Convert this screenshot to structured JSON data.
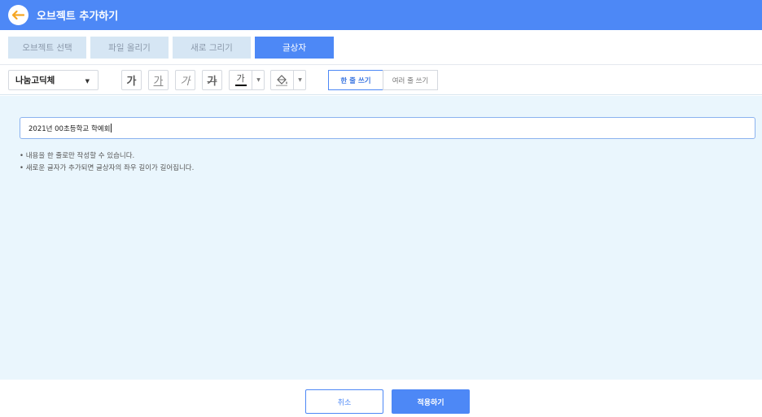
{
  "header": {
    "title": "오브젝트 추가하기"
  },
  "tabs": [
    {
      "label": "오브젝트 선택"
    },
    {
      "label": "파일 올리기"
    },
    {
      "label": "새로 그리기"
    },
    {
      "label": "글상자"
    }
  ],
  "toolbar": {
    "font": "나눔고딕체",
    "bold": "가",
    "underline": "가",
    "italic": "가",
    "strike": "가",
    "text_color_glyph": "가",
    "single_line": "한 줄 쓰기",
    "multi_line": "여러 줄 쓰기"
  },
  "editor": {
    "value": "2021년 00초등학교 학예회",
    "notes": [
      "• 내용을 한 줄로만 작성할 수 있습니다.",
      "• 새로운 글자가 추가되면 글상자의 좌우 길이가 길어집니다."
    ]
  },
  "footer": {
    "cancel": "취소",
    "apply": "적용하기"
  },
  "colors": {
    "accent": "#4d88f6",
    "back_arrow": "#f5a623",
    "content_bg": "#eaf6fd"
  }
}
